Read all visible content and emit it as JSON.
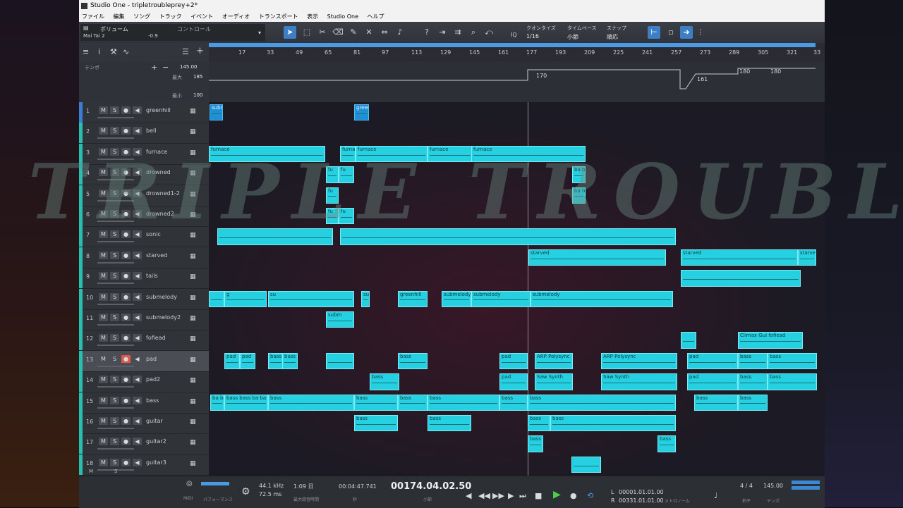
{
  "window": {
    "title": "Studio One - tripletroubleprey+2*"
  },
  "menu": [
    "ファイル",
    "編集",
    "ソング",
    "トラック",
    "イベント",
    "オーディオ",
    "トランスポート",
    "表示",
    "Studio One",
    "ヘルプ"
  ],
  "toolbar": {
    "channel_name": "Mai Tai 2",
    "volume_label": "ボリューム",
    "volume_value": "-0.9",
    "control_label": "コントロール",
    "quantize_label": "クオンタイズ",
    "quantize_value": "1/16",
    "timebase_label": "タイムベース",
    "timebase_value": "小節",
    "snap_label": "スナップ",
    "snap_value": "順応",
    "iq_label": "IQ"
  },
  "ruler": {
    "ticks": [
      "17",
      "33",
      "49",
      "65",
      "81",
      "97",
      "113",
      "129",
      "145",
      "161",
      "177",
      "193",
      "209",
      "225",
      "241",
      "257",
      "273",
      "289",
      "305",
      "321",
      "33"
    ]
  },
  "tempo": {
    "label": "テンポ",
    "value": "145.00",
    "max_label": "最大",
    "max_value": "185",
    "min_label": "最小",
    "min_value": "100",
    "point_labels": [
      "170",
      "161",
      "180",
      "180"
    ]
  },
  "tracks": [
    {
      "num": "1",
      "name": "greenhill",
      "color": "#3a7ed8"
    },
    {
      "num": "2",
      "name": "bell",
      "color": "#25c0b0"
    },
    {
      "num": "3",
      "name": "furnace",
      "color": "#25c0b0"
    },
    {
      "num": "4",
      "name": "drowned",
      "color": "#25c0b0"
    },
    {
      "num": "5",
      "name": "drowned1-2",
      "color": "#25c0b0"
    },
    {
      "num": "6",
      "name": "drowned2",
      "color": "#25c0b0"
    },
    {
      "num": "7",
      "name": "sonic",
      "color": "#25c0b0"
    },
    {
      "num": "8",
      "name": "starved",
      "color": "#25c0b0"
    },
    {
      "num": "9",
      "name": "tails",
      "color": "#25c0b0"
    },
    {
      "num": "10",
      "name": "submelody",
      "color": "#25c0b0"
    },
    {
      "num": "11",
      "name": "submelody2",
      "color": "#25c0b0"
    },
    {
      "num": "12",
      "name": "fofiead",
      "color": "#25c0b0"
    },
    {
      "num": "13",
      "name": "pad",
      "color": "#25c0b0"
    },
    {
      "num": "14",
      "name": "pad2",
      "color": "#25c0b0"
    },
    {
      "num": "15",
      "name": "bass",
      "color": "#25c0b0"
    },
    {
      "num": "16",
      "name": "guitar",
      "color": "#25c0b0"
    },
    {
      "num": "17",
      "name": "guitar2",
      "color": "#25c0b0"
    },
    {
      "num": "18",
      "name": "guitar3",
      "color": "#25c0b0"
    }
  ],
  "track_buttons": {
    "mute": "M",
    "solo": "S",
    "rec": "●",
    "monitor": "◀",
    "keyboard": "▦"
  },
  "clips": [
    {
      "label": "subm",
      "sel": true
    },
    {
      "label": "greer",
      "sel": true
    },
    {
      "label": "furnace"
    },
    {
      "label": "furna"
    },
    {
      "label": "furnace"
    },
    {
      "label": "furnace"
    },
    {
      "label": "furnace"
    },
    {
      "label": "fu"
    },
    {
      "label": "fu"
    },
    {
      "label": "ba ba"
    },
    {
      "label": "fu"
    },
    {
      "label": "ba ba"
    },
    {
      "label": "fu"
    },
    {
      "label": "fu"
    },
    {
      "label": ""
    },
    {
      "label": ""
    },
    {
      "label": "starved"
    },
    {
      "label": "starved"
    },
    {
      "label": "starved"
    },
    {
      "label": ""
    },
    {
      "label": ""
    },
    {
      "label": "g"
    },
    {
      "label": "su"
    },
    {
      "label": "submelody"
    },
    {
      "label": "greenhill"
    },
    {
      "label": "submelody"
    },
    {
      "label": "submelody"
    },
    {
      "label": "submelody"
    },
    {
      "label": "subm"
    },
    {
      "label": ""
    },
    {
      "label": "Climax Gui fofiead"
    },
    {
      "label": "pad"
    },
    {
      "label": "pad"
    },
    {
      "label": "bass"
    },
    {
      "label": "bass"
    },
    {
      "label": ""
    },
    {
      "label": "bass"
    },
    {
      "label": "pad"
    },
    {
      "label": "ARP Polysync"
    },
    {
      "label": "ARP Polysync"
    },
    {
      "label": "pad"
    },
    {
      "label": "bass"
    },
    {
      "label": "bass"
    },
    {
      "label": "bass"
    },
    {
      "label": "pad"
    },
    {
      "label": "Saw Synth"
    },
    {
      "label": "Saw Synth"
    },
    {
      "label": "pad"
    },
    {
      "label": "bass"
    },
    {
      "label": "bass"
    },
    {
      "label": "ba be ba ba ba"
    },
    {
      "label": "bass bass ba ba ba"
    },
    {
      "label": "bass"
    },
    {
      "label": "bass"
    },
    {
      "label": "bass"
    },
    {
      "label": "bass"
    },
    {
      "label": "bass"
    },
    {
      "label": "bass"
    },
    {
      "label": "bass"
    },
    {
      "label": "bass"
    },
    {
      "label": "bass"
    },
    {
      "label": "bass"
    },
    {
      "label": "bass"
    },
    {
      "label": "bass"
    },
    {
      "label": "bass"
    },
    {
      "label": "bass"
    },
    {
      "label": ""
    }
  ],
  "watermark": "TRIPLE TROUBLE",
  "statusbar": {
    "midi_label": "MIDI",
    "perf_label": "パフォーマンス",
    "sample_rate": "44.1 kHz",
    "latency": "72.5 ms",
    "record_time": "1:09 日",
    "record_label": "最大録音時間",
    "time_seconds": "00:04:47.741",
    "time_seconds_label": "秒",
    "position": "00174.04.02.50",
    "position_label": "小節",
    "loop_start": "00001.01.01.00",
    "loop_end": "00331.01.01.00",
    "loop_l": "L",
    "loop_r": "R",
    "metronome_label": "メトロノーム",
    "signature": "4 / 4",
    "signature_label": "拍子",
    "tempo_value": "145.00",
    "tempo_label": "テンポ"
  }
}
